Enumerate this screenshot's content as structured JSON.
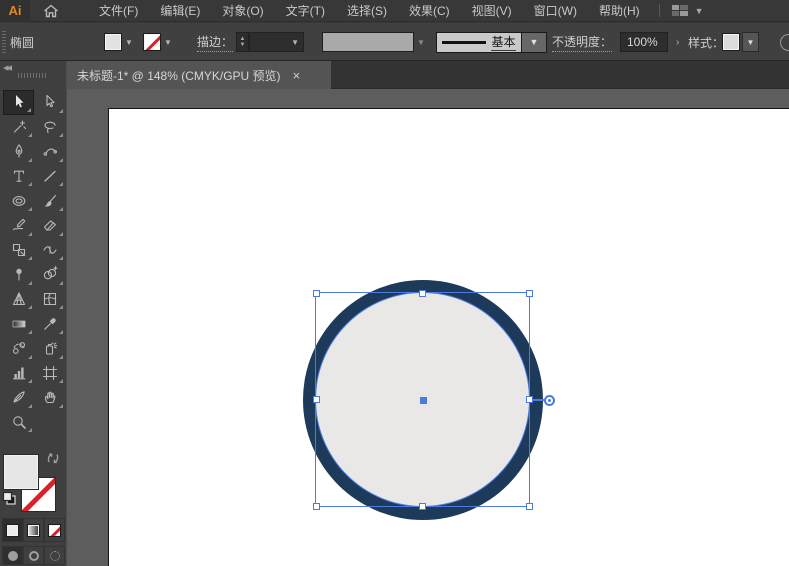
{
  "menu_bar": {
    "logo_text": "Ai",
    "items": [
      "文件(F)",
      "编辑(E)",
      "对象(O)",
      "文字(T)",
      "选择(S)",
      "效果(C)",
      "视图(V)",
      "窗口(W)",
      "帮助(H)"
    ]
  },
  "control_bar": {
    "context_label": "椭圆",
    "stroke_label": "描边：",
    "brush_style_label": "基本",
    "opacity_label": "不透明度：",
    "opacity_value": "100%",
    "opacity_more_glyph": "›",
    "style_label": "样式："
  },
  "document_tab": {
    "title": "未标题-1* @ 148% (CMYK/GPU 预览)",
    "close_glyph": "×"
  },
  "toolbar": {
    "tools": [
      {
        "name": "selection",
        "active": true
      },
      {
        "name": "direct-selection"
      },
      {
        "name": "magic-wand"
      },
      {
        "name": "lasso"
      },
      {
        "name": "pen"
      },
      {
        "name": "curvature"
      },
      {
        "name": "type"
      },
      {
        "name": "line-segment"
      },
      {
        "name": "ellipse"
      },
      {
        "name": "paintbrush"
      },
      {
        "name": "shaper"
      },
      {
        "name": "eraser"
      },
      {
        "name": "scale"
      },
      {
        "name": "width"
      },
      {
        "name": "puppet-warp"
      },
      {
        "name": "shape-builder"
      },
      {
        "name": "perspective-grid"
      },
      {
        "name": "mesh"
      },
      {
        "name": "gradient"
      },
      {
        "name": "eyedropper"
      },
      {
        "name": "blend"
      },
      {
        "name": "symbol-sprayer"
      },
      {
        "name": "column-graph"
      },
      {
        "name": "artboard"
      },
      {
        "name": "knife"
      },
      {
        "name": "hand"
      },
      {
        "name": "zoom"
      }
    ]
  },
  "canvas": {
    "zoom": "148%",
    "color_mode": "CMYK/GPU 预览",
    "shape": {
      "type": "ellipse",
      "selected": true,
      "fill": "#e9e8e6",
      "stroke": "#1e3a5a"
    }
  },
  "colors": {
    "accent_logo": "#e0872f",
    "selection_blue": "#4a7be0",
    "ring_navy": "#1e3a5a",
    "shape_fill": "#e9e8e6",
    "none_red": "#d8222a",
    "pasteboard": "#5d5d5d"
  }
}
